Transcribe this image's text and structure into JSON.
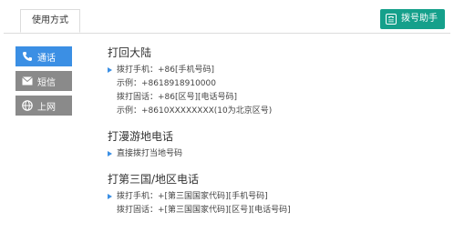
{
  "tabs": [
    {
      "label": "使用方式"
    }
  ],
  "dial_button": {
    "label": "拨号助手"
  },
  "sidebar": {
    "items": [
      {
        "label": "通话",
        "icon": "phone-icon",
        "active": true
      },
      {
        "label": "短信",
        "icon": "envelope-icon",
        "active": false
      },
      {
        "label": "上网",
        "icon": "globe-icon",
        "active": false
      }
    ]
  },
  "content": {
    "sections": [
      {
        "title": "打回大陆",
        "lines": [
          "拨打手机：+86[手机号码]",
          "示例：+8618918910000",
          "拨打固话：+86[区号][电话号码]",
          "示例：+8610XXXXXXXX(10为北京区号)"
        ]
      },
      {
        "title": "打漫游地电话",
        "lines": [
          "直接拨打当地号码"
        ]
      },
      {
        "title": "打第三国/地区电话",
        "lines": [
          "拨打手机：+[第三国国家代码][手机号码]",
          "拨打固话：+[第三国国家代码][区号][电话号码]"
        ]
      }
    ]
  },
  "colors": {
    "accent_blue": "#3b8fe4",
    "dial_green": "#15a08b",
    "sidebar_gray": "#8a8a8a"
  }
}
